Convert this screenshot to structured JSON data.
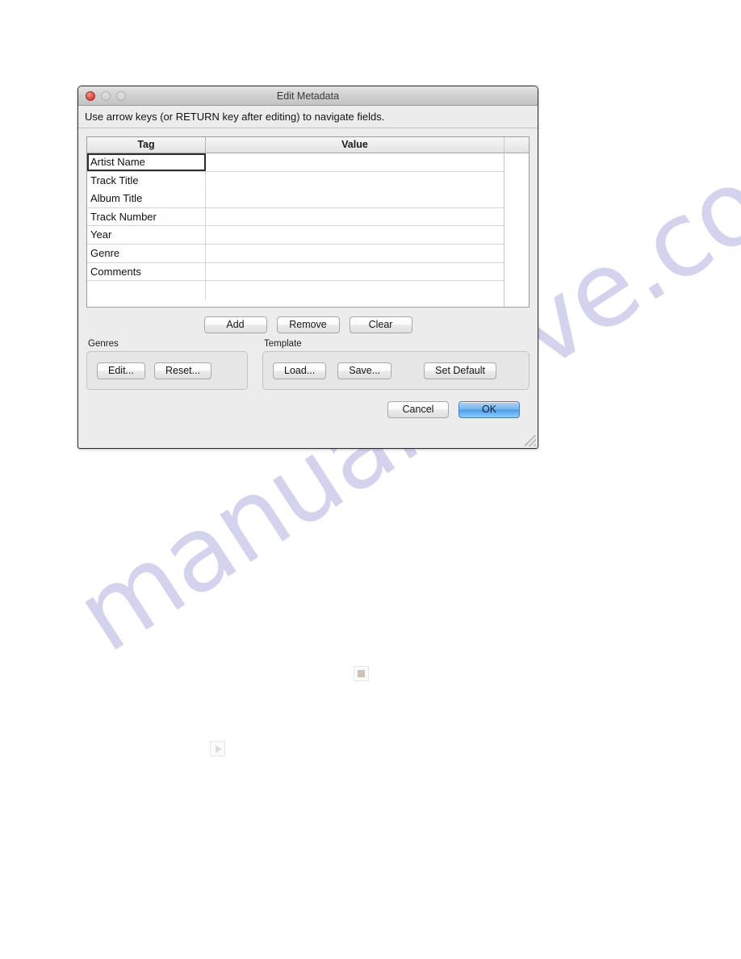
{
  "window": {
    "title": "Edit Metadata",
    "traffic_lights": [
      {
        "name": "close",
        "state": "active"
      },
      {
        "name": "minimize",
        "state": "disabled"
      },
      {
        "name": "zoom",
        "state": "disabled"
      }
    ],
    "instruction": "Use arrow keys (or RETURN key after editing) to navigate fields."
  },
  "table": {
    "headers": [
      "Tag",
      "Value"
    ],
    "rows": [
      {
        "tag": "Artist Name",
        "value": "",
        "selected": true,
        "separator": true
      },
      {
        "tag": "Track Title",
        "value": "",
        "selected": false,
        "separator": false
      },
      {
        "tag": "Album Title",
        "value": "",
        "selected": false,
        "separator": true
      },
      {
        "tag": "Track Number",
        "value": "",
        "selected": false,
        "separator": true
      },
      {
        "tag": "Year",
        "value": "",
        "selected": false,
        "separator": true
      },
      {
        "tag": "Genre",
        "value": "",
        "selected": false,
        "separator": true
      },
      {
        "tag": "Comments",
        "value": "",
        "selected": false,
        "separator": true
      },
      {
        "tag": "",
        "value": "",
        "selected": false,
        "separator": true
      }
    ]
  },
  "row_actions": {
    "add_label": "Add",
    "remove_label": "Remove",
    "clear_label": "Clear"
  },
  "genres_group": {
    "title": "Genres",
    "edit_label": "Edit...",
    "reset_label": "Reset..."
  },
  "template_group": {
    "title": "Template",
    "load_label": "Load...",
    "save_label": "Save...",
    "set_default_label": "Set Default"
  },
  "footer": {
    "cancel_label": "Cancel",
    "ok_label": "OK"
  },
  "page": {
    "watermark_text": "manualshive.com",
    "watermark_color": "#c9c7ea"
  },
  "stray_icons": [
    {
      "name": "broken-image-icon"
    },
    {
      "name": "play-icon"
    }
  ]
}
